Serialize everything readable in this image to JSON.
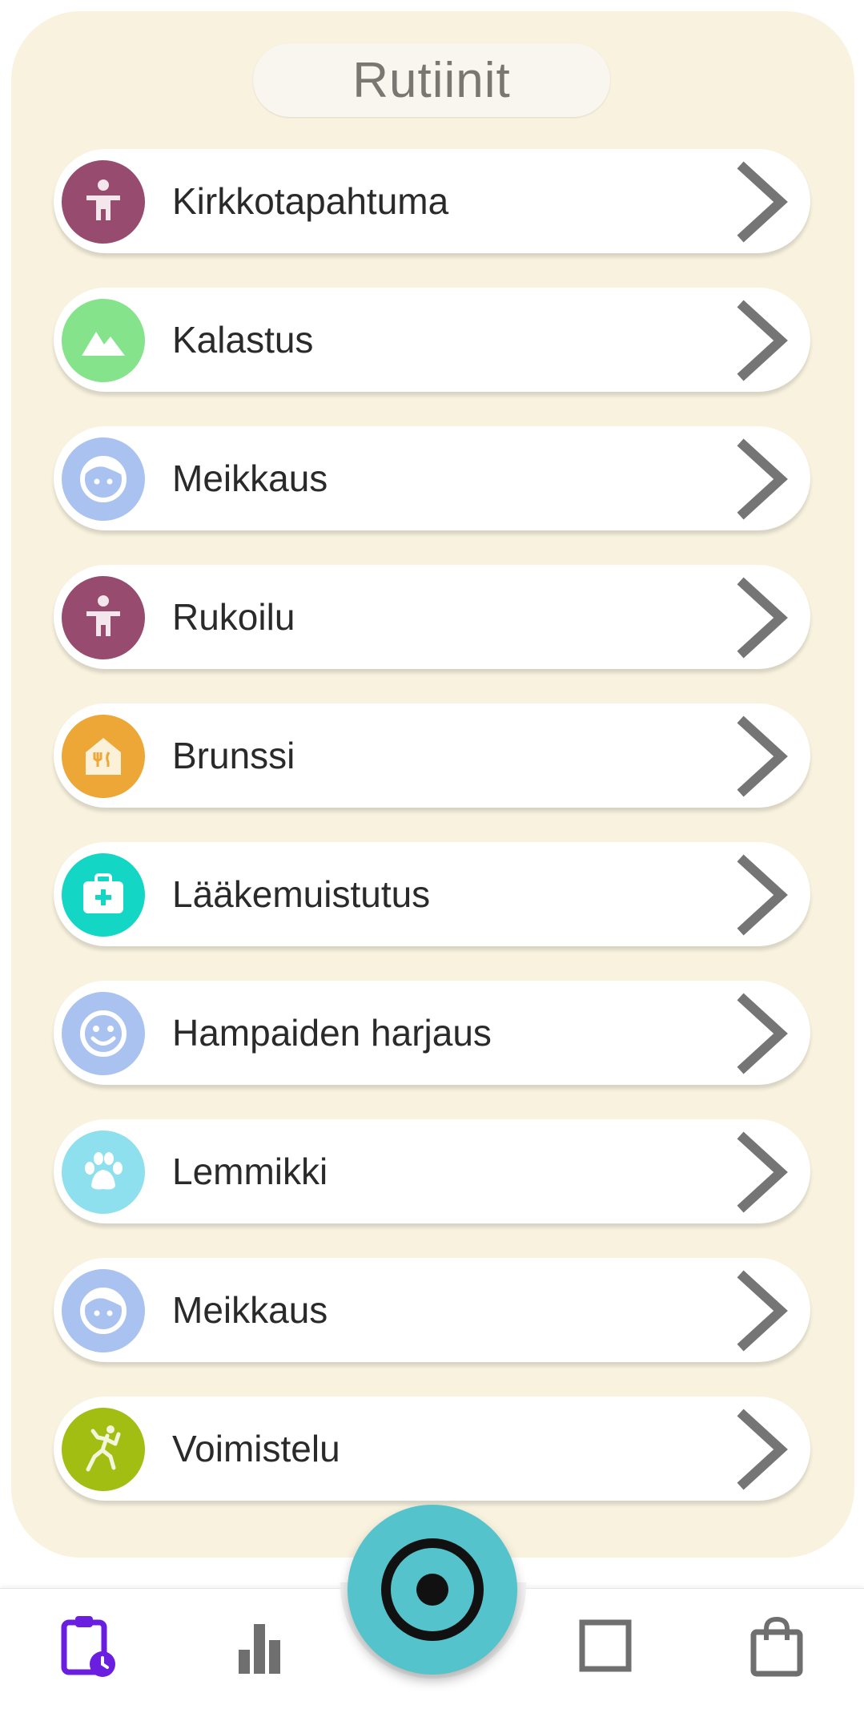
{
  "header": {
    "title": "Rutiinit"
  },
  "routines": [
    {
      "label": "Kirkkotapahtuma",
      "icon": "person-arms-icon",
      "color": "#974b6e"
    },
    {
      "label": "Kalastus",
      "icon": "mountain-icon",
      "color": "#84e38b"
    },
    {
      "label": "Meikkaus",
      "icon": "face-icon",
      "color": "#a9c2f0"
    },
    {
      "label": "Rukoilu",
      "icon": "person-arms-icon",
      "color": "#974b6e"
    },
    {
      "label": "Brunssi",
      "icon": "restaurant-icon",
      "color": "#eca736"
    },
    {
      "label": "Lääkemuistutus",
      "icon": "medical-kit-icon",
      "color": "#13d6c4"
    },
    {
      "label": "Hampaiden harjaus",
      "icon": "smiley-icon",
      "color": "#a9c2f0"
    },
    {
      "label": "Lemmikki",
      "icon": "paw-icon",
      "color": "#8ee0ee"
    },
    {
      "label": "Meikkaus",
      "icon": "face-icon",
      "color": "#a9c2f0"
    },
    {
      "label": "Voimistelu",
      "icon": "gymnast-icon",
      "color": "#a3be12"
    }
  ],
  "bottom_nav": {
    "items": [
      {
        "name": "routines-tab",
        "icon": "clipboard-clock-icon",
        "active": true
      },
      {
        "name": "stats-tab",
        "icon": "bar-chart-icon",
        "active": false
      },
      {
        "name": "record-button",
        "icon": "target-icon",
        "active": false
      },
      {
        "name": "square-tab",
        "icon": "square-icon",
        "active": false
      },
      {
        "name": "shop-tab",
        "icon": "shopping-bag-icon",
        "active": false
      }
    ]
  },
  "colors": {
    "panel": "#f8f2df",
    "accent": "#6a1fe0",
    "fab": "#55c3cb",
    "chevron": "#757575"
  }
}
